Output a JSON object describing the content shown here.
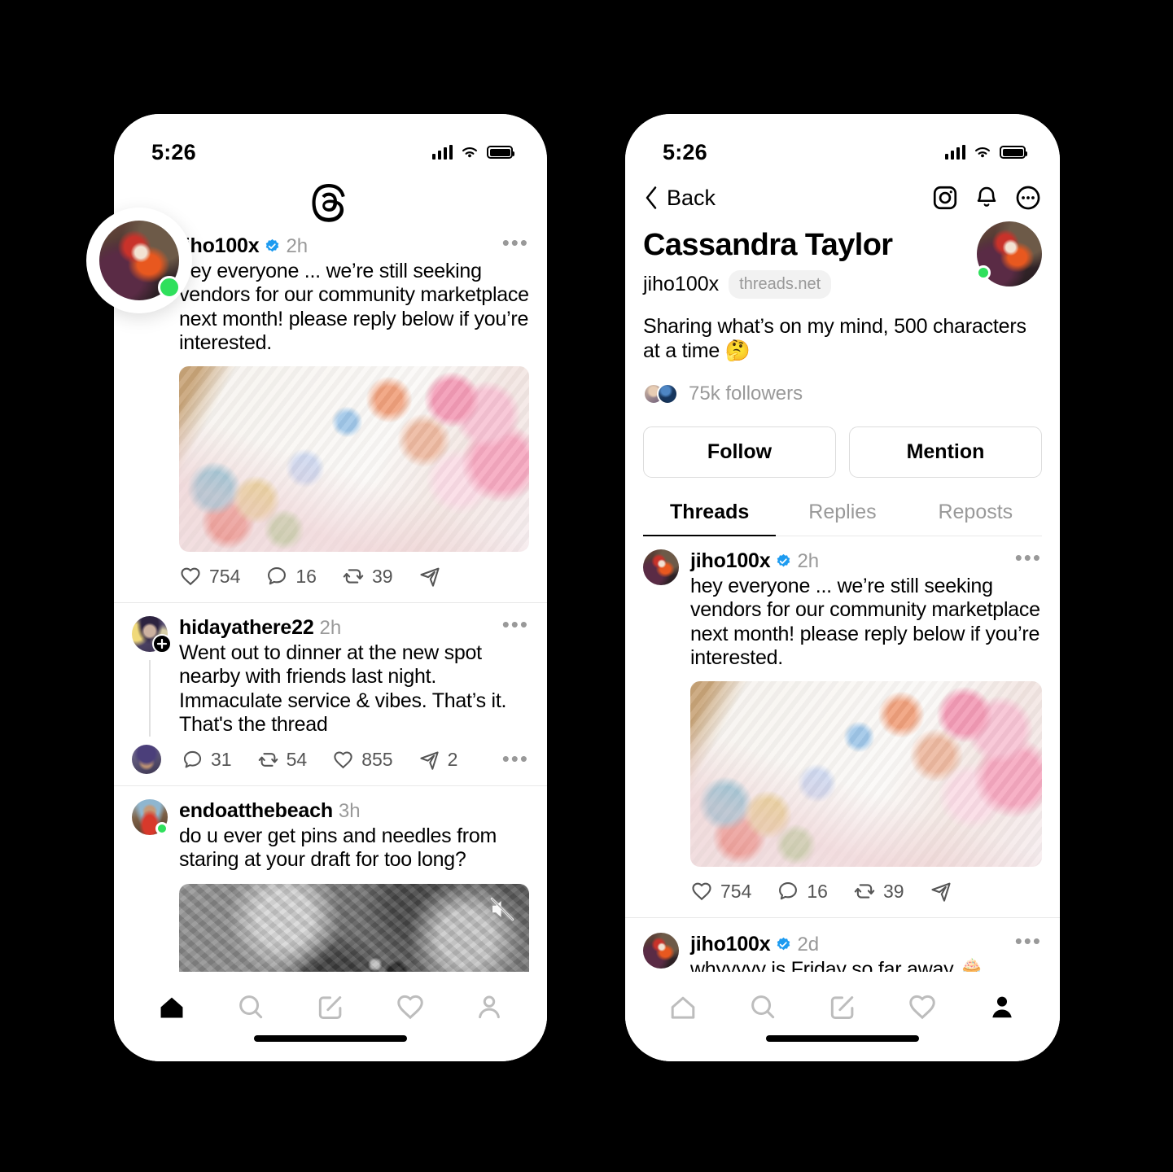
{
  "left_phone": {
    "status_bar": {
      "time": "5:26",
      "signal": "signal-bars",
      "wifi": "wifi",
      "battery": "battery-full"
    },
    "app_logo": "threads-logo",
    "avatar_overlay": {
      "name": "jiho100x",
      "status": "online"
    },
    "feed": [
      {
        "username": "jiho100x",
        "verified": true,
        "timestamp": "2h",
        "text": "hey everyone ... we’re still seeking vendors for our community marketplace next month! please reply below if you’re interested.",
        "media": "stickers-photo",
        "actions": {
          "likes": "754",
          "replies": "16",
          "reposts": "39",
          "share": ""
        }
      },
      {
        "username": "hidayathere22",
        "verified": false,
        "timestamp": "2h",
        "text": "Went out to dinner at the new spot nearby with friends last night. Immaculate service & vibes. That’s it. That's the thread",
        "media": null,
        "follow_badge": true,
        "actions": {
          "replies": "31",
          "reposts": "54",
          "likes": "855",
          "share": "2"
        }
      },
      {
        "username": "endoatthebeach",
        "verified": false,
        "timestamp": "3h",
        "text": "do u ever get pins and needles from staring at your draft for too long?",
        "media": "moon-video",
        "muted": true,
        "status": "online"
      }
    ],
    "tabbar": {
      "items": [
        {
          "name": "home",
          "icon": "home-icon",
          "active": true
        },
        {
          "name": "search",
          "icon": "search-icon",
          "active": false
        },
        {
          "name": "compose",
          "icon": "compose-icon",
          "active": false
        },
        {
          "name": "activity",
          "icon": "heart-icon",
          "active": false
        },
        {
          "name": "profile",
          "icon": "person-icon",
          "active": false
        }
      ]
    }
  },
  "right_phone": {
    "status_bar": {
      "time": "5:26",
      "signal": "signal-bars",
      "wifi": "wifi",
      "battery": "battery-full"
    },
    "nav": {
      "back_label": "Back",
      "icons": [
        {
          "name": "instagram",
          "icon": "instagram-icon"
        },
        {
          "name": "notifications",
          "icon": "bell-icon"
        },
        {
          "name": "more",
          "icon": "more-circle-icon"
        }
      ]
    },
    "profile": {
      "display_name": "Cassandra Taylor",
      "handle": "jiho100x",
      "domain_pill": "threads.net",
      "bio": "Sharing what’s on my mind, 500 characters at a time 🤔",
      "followers_count": "75k followers",
      "status": "online",
      "buttons": [
        {
          "label": "Follow",
          "name": "follow-button"
        },
        {
          "label": "Mention",
          "name": "mention-button"
        }
      ],
      "tabs": [
        {
          "label": "Threads",
          "active": true
        },
        {
          "label": "Replies",
          "active": false
        },
        {
          "label": "Reposts",
          "active": false
        }
      ]
    },
    "posts": [
      {
        "username": "jiho100x",
        "verified": true,
        "timestamp": "2h",
        "text": "hey everyone ... we’re still seeking vendors for our community marketplace next month! please reply below if you’re interested.",
        "media": "stickers-photo",
        "actions": {
          "likes": "754",
          "replies": "16",
          "reposts": "39",
          "share": ""
        }
      },
      {
        "username": "jiho100x",
        "verified": true,
        "timestamp": "2d",
        "text": "whyyyyy is Friday so far away 🧁",
        "media": null
      }
    ],
    "tabbar": {
      "items": [
        {
          "name": "home",
          "icon": "home-icon",
          "active": false
        },
        {
          "name": "search",
          "icon": "search-icon",
          "active": false
        },
        {
          "name": "compose",
          "icon": "compose-icon",
          "active": false
        },
        {
          "name": "activity",
          "icon": "heart-icon",
          "active": false
        },
        {
          "name": "profile",
          "icon": "person-icon",
          "active": true
        }
      ]
    }
  },
  "colors": {
    "verified_blue": "#1d9bf0",
    "online_green": "#2fe05c",
    "background": "#000000",
    "screen": "#ffffff",
    "muted_text": "#999999"
  }
}
